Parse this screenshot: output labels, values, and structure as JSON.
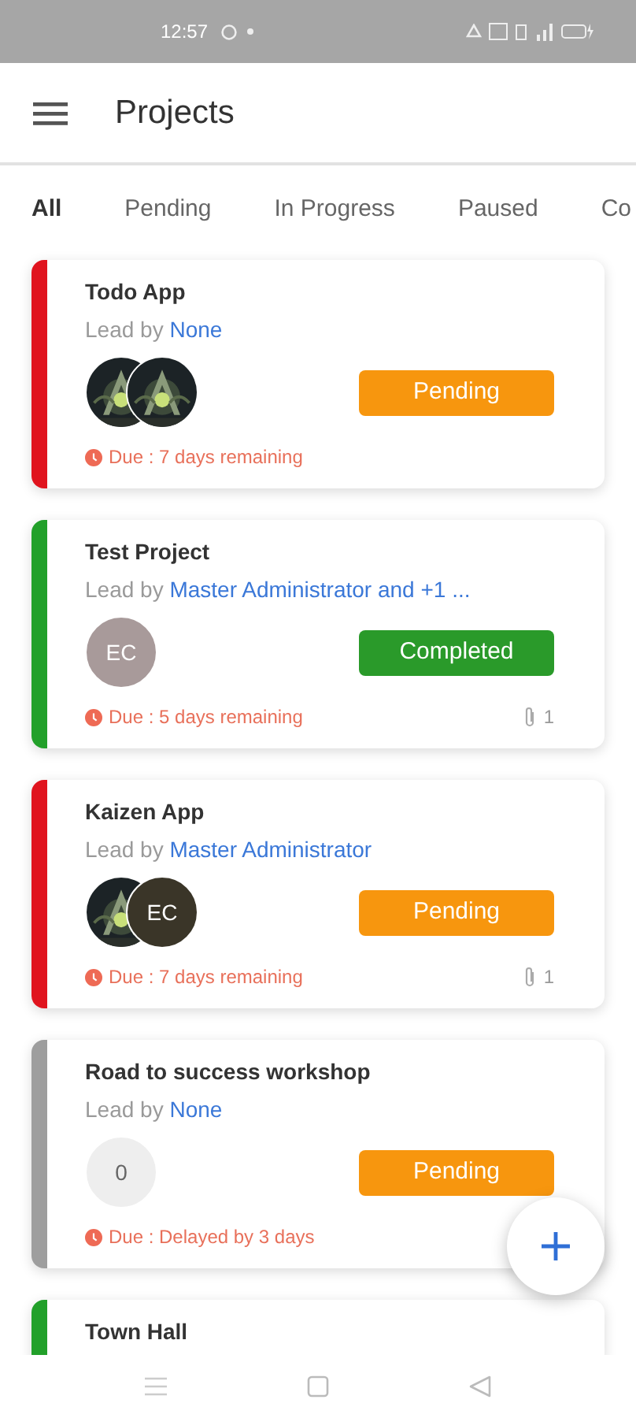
{
  "status_bar": {
    "time": "12:57"
  },
  "app_bar": {
    "title": "Projects"
  },
  "tabs": [
    {
      "label": "All",
      "selected": true
    },
    {
      "label": "Pending",
      "selected": false
    },
    {
      "label": "In Progress",
      "selected": false
    },
    {
      "label": "Paused",
      "selected": false
    },
    {
      "label": "Co",
      "selected": false
    }
  ],
  "projects": [
    {
      "title": "Todo App",
      "lead_label": "Lead by",
      "lead": "None",
      "color": "#e0141e",
      "members": [
        {
          "kind": "picture"
        },
        {
          "kind": "picture"
        }
      ],
      "status": {
        "label": "Pending",
        "color": "#f7960e"
      },
      "due": "Due : 7 days remaining"
    },
    {
      "title": "Test Project",
      "lead_label": "Lead by",
      "lead": "Master Administrator and +1 ...",
      "color": "#22a02a",
      "members": [
        {
          "kind": "initials",
          "text": "EC",
          "color": "#a89a9a"
        }
      ],
      "status": {
        "label": "Completed",
        "color": "#2a9a2a"
      },
      "due": "Due : 5 days remaining",
      "attachments": "1"
    },
    {
      "title": "Kaizen App",
      "lead_label": "Lead by",
      "lead": "Master Administrator",
      "color": "#e0141e",
      "members": [
        {
          "kind": "picture"
        },
        {
          "kind": "initials",
          "text": "EC",
          "color": "#3a3528"
        }
      ],
      "status": {
        "label": "Pending",
        "color": "#f7960e"
      },
      "due": "Due : 7 days remaining",
      "attachments": "1"
    },
    {
      "title": "Road to success workshop",
      "lead_label": "Lead by",
      "lead": "None",
      "color": "#9e9e9e",
      "members": [
        {
          "kind": "count",
          "text": "0",
          "color": "#eeeeee"
        }
      ],
      "status": {
        "label": "Pending",
        "color": "#f7960e"
      },
      "due": "Due : Delayed by 3 days"
    },
    {
      "title": "Town Hall",
      "color": "#22a02a"
    }
  ]
}
